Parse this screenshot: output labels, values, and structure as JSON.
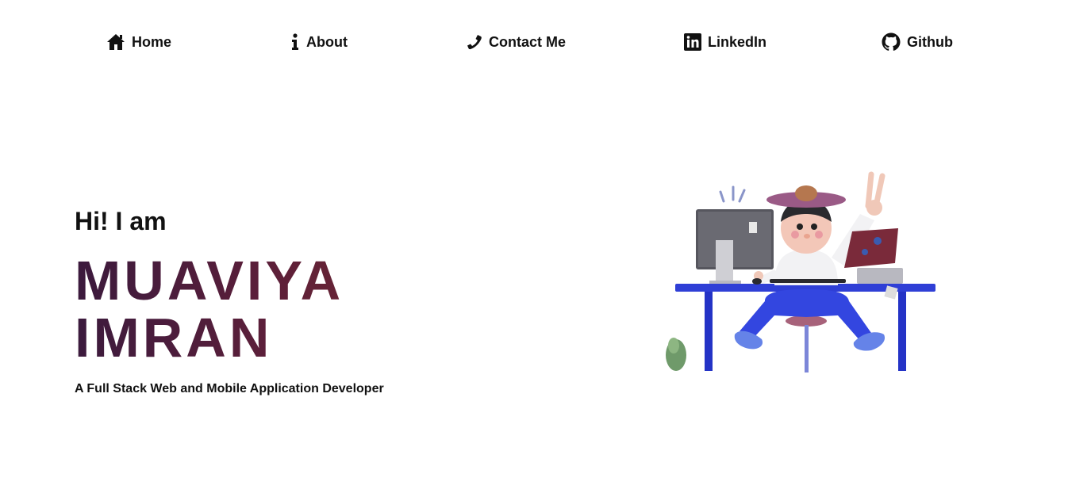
{
  "nav": {
    "items": [
      {
        "label": "Home",
        "icon": "home-icon"
      },
      {
        "label": "About",
        "icon": "info-icon"
      },
      {
        "label": "Contact Me",
        "icon": "phone-icon"
      },
      {
        "label": "LinkedIn",
        "icon": "linkedin-icon"
      },
      {
        "label": "Github",
        "icon": "github-icon"
      }
    ]
  },
  "hero": {
    "greeting": "Hi! I am",
    "name_line1": "MUAVIYA",
    "name_line2": "IMRAN",
    "tagline": "A Full Stack Web and Mobile Application Developer",
    "illustration": "developer-at-desk-illustration"
  },
  "colors": {
    "name_gradient_start": "#3b1a3d",
    "name_gradient_end": "#7a2a2c",
    "desk_blue": "#2f3fd6",
    "text": "#111111",
    "background": "#ffffff"
  }
}
